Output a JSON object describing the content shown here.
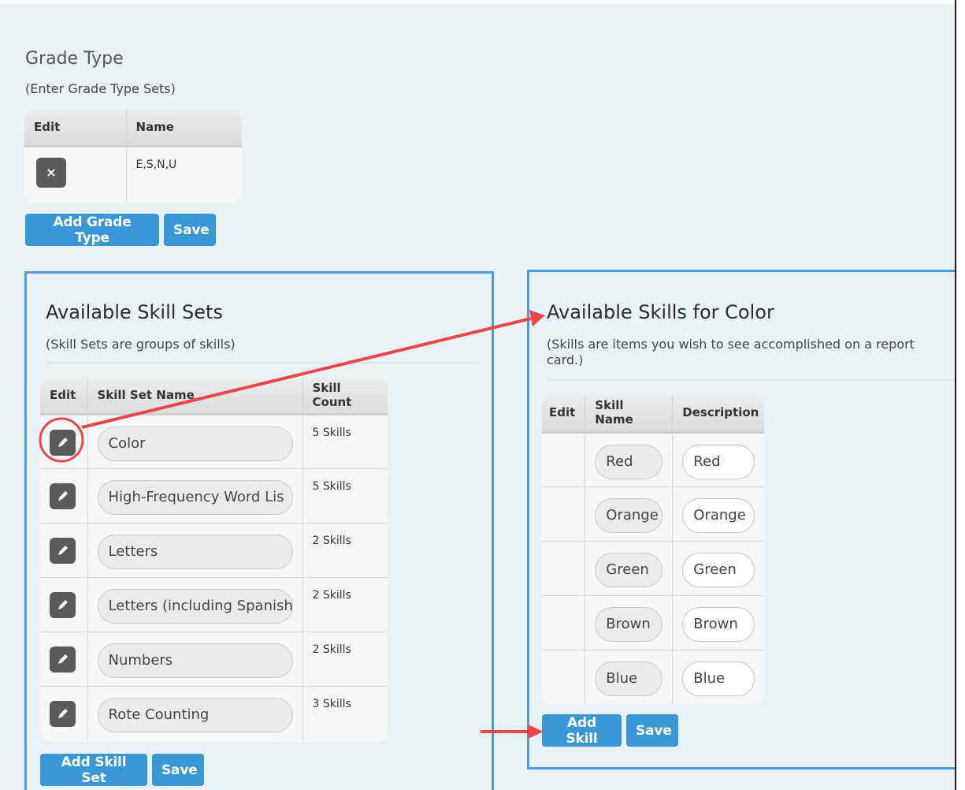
{
  "grade_type": {
    "title": "Grade Type",
    "subtitle": "(Enter Grade Type Sets)",
    "columns": [
      "Edit",
      "Name"
    ],
    "rows": [
      {
        "delete_icon": "×",
        "name": "E,S,N,U"
      }
    ],
    "add_button": "Add Grade Type",
    "save_button": "Save"
  },
  "skill_sets": {
    "title": "Available Skill Sets",
    "subtitle": "(Skill Sets are groups of skills)",
    "columns": [
      "Edit",
      "Skill Set Name",
      "Skill Count"
    ],
    "rows": [
      {
        "name": "Color",
        "count": "5 Skills"
      },
      {
        "name": "High-Frequency Word Lis",
        "count": "5 Skills"
      },
      {
        "name": "Letters",
        "count": "2 Skills"
      },
      {
        "name": "Letters (including Spanish",
        "count": "2 Skills"
      },
      {
        "name": "Numbers",
        "count": "2 Skills"
      },
      {
        "name": "Rote Counting",
        "count": "3 Skills"
      }
    ],
    "add_button": "Add Skill Set",
    "save_button": "Save"
  },
  "skills": {
    "title": "Available Skills for Color",
    "subtitle_line1": "(Skills are items you wish to see accomplished on a report",
    "subtitle_line2": "card.)",
    "columns": [
      "Edit",
      "Skill Name",
      "Description"
    ],
    "rows": [
      {
        "name": "Red",
        "description": "Red"
      },
      {
        "name": "Orange",
        "description": "Orange"
      },
      {
        "name": "Green",
        "description": "Green"
      },
      {
        "name": "Brown",
        "description": "Brown"
      },
      {
        "name": "Blue",
        "description": "Blue"
      }
    ],
    "add_button": "Add Skill",
    "save_button": "Save"
  },
  "colors": {
    "page_background": "#eaf1f5",
    "button_blue": "#3a97d6",
    "panel_border": "#4a9de0",
    "annotation_red": "#e5484d",
    "icon_button_gray": "#5a5a5a"
  },
  "icons": {
    "delete": "close-icon",
    "edit": "pencil-icon"
  }
}
